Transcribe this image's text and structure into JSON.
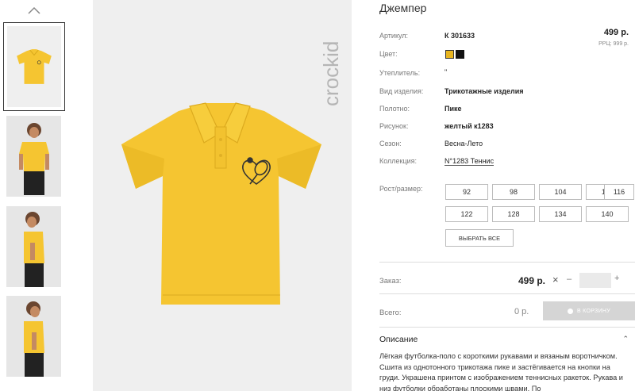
{
  "product": {
    "title": "Джемпер",
    "price": "499 р.",
    "rrp": "РРЦ: 999 р.",
    "attributes": [
      {
        "label": "Артикул:",
        "value": "К 301633"
      },
      {
        "label": "Цвет:",
        "value": ""
      },
      {
        "label": "Утеплитель:",
        "value": "\""
      },
      {
        "label": "Вид изделия:",
        "value": "Трикотажные изделия"
      },
      {
        "label": "Полотно:",
        "value": "Пике"
      },
      {
        "label": "Рисунок:",
        "value": "желтый к1283"
      },
      {
        "label": "Сезон:",
        "value": "Весна-Лето"
      },
      {
        "label": "Коллекция:",
        "value": "N°1283 Теннис"
      }
    ],
    "colors": [
      "#e8b51f",
      "#111111"
    ]
  },
  "sizes": {
    "label": "Рост/размер:",
    "options": [
      "92",
      "98",
      "104",
      "110",
      "116",
      "122",
      "128",
      "134",
      "140"
    ],
    "select_all": "ВЫБРАТЬ ВСЕ"
  },
  "order": {
    "label": "Заказ:",
    "price": "499 р.",
    "times": "×",
    "minus": "–",
    "plus": "+",
    "qty": ""
  },
  "total": {
    "label": "Всего:",
    "value": "0 р.",
    "cart_button": "В КОРЗИНУ"
  },
  "description": {
    "title": "Описание",
    "text": "Лёгкая футболка-поло с короткими рукавами и вязаным воротничком. Сшита из однотонного трикотажа пике и застёгивается на кнопки на груди. Украшена принтом с изображением теннисных ракеток. Рукава и низ футболки обработаны плоскими швами. По"
  },
  "brand": {
    "name": "crockid"
  },
  "colors": {
    "shirt": "#f5c531",
    "shirt_dark": "#e2b226",
    "skin": "#c48a62",
    "pants": "#222222"
  }
}
